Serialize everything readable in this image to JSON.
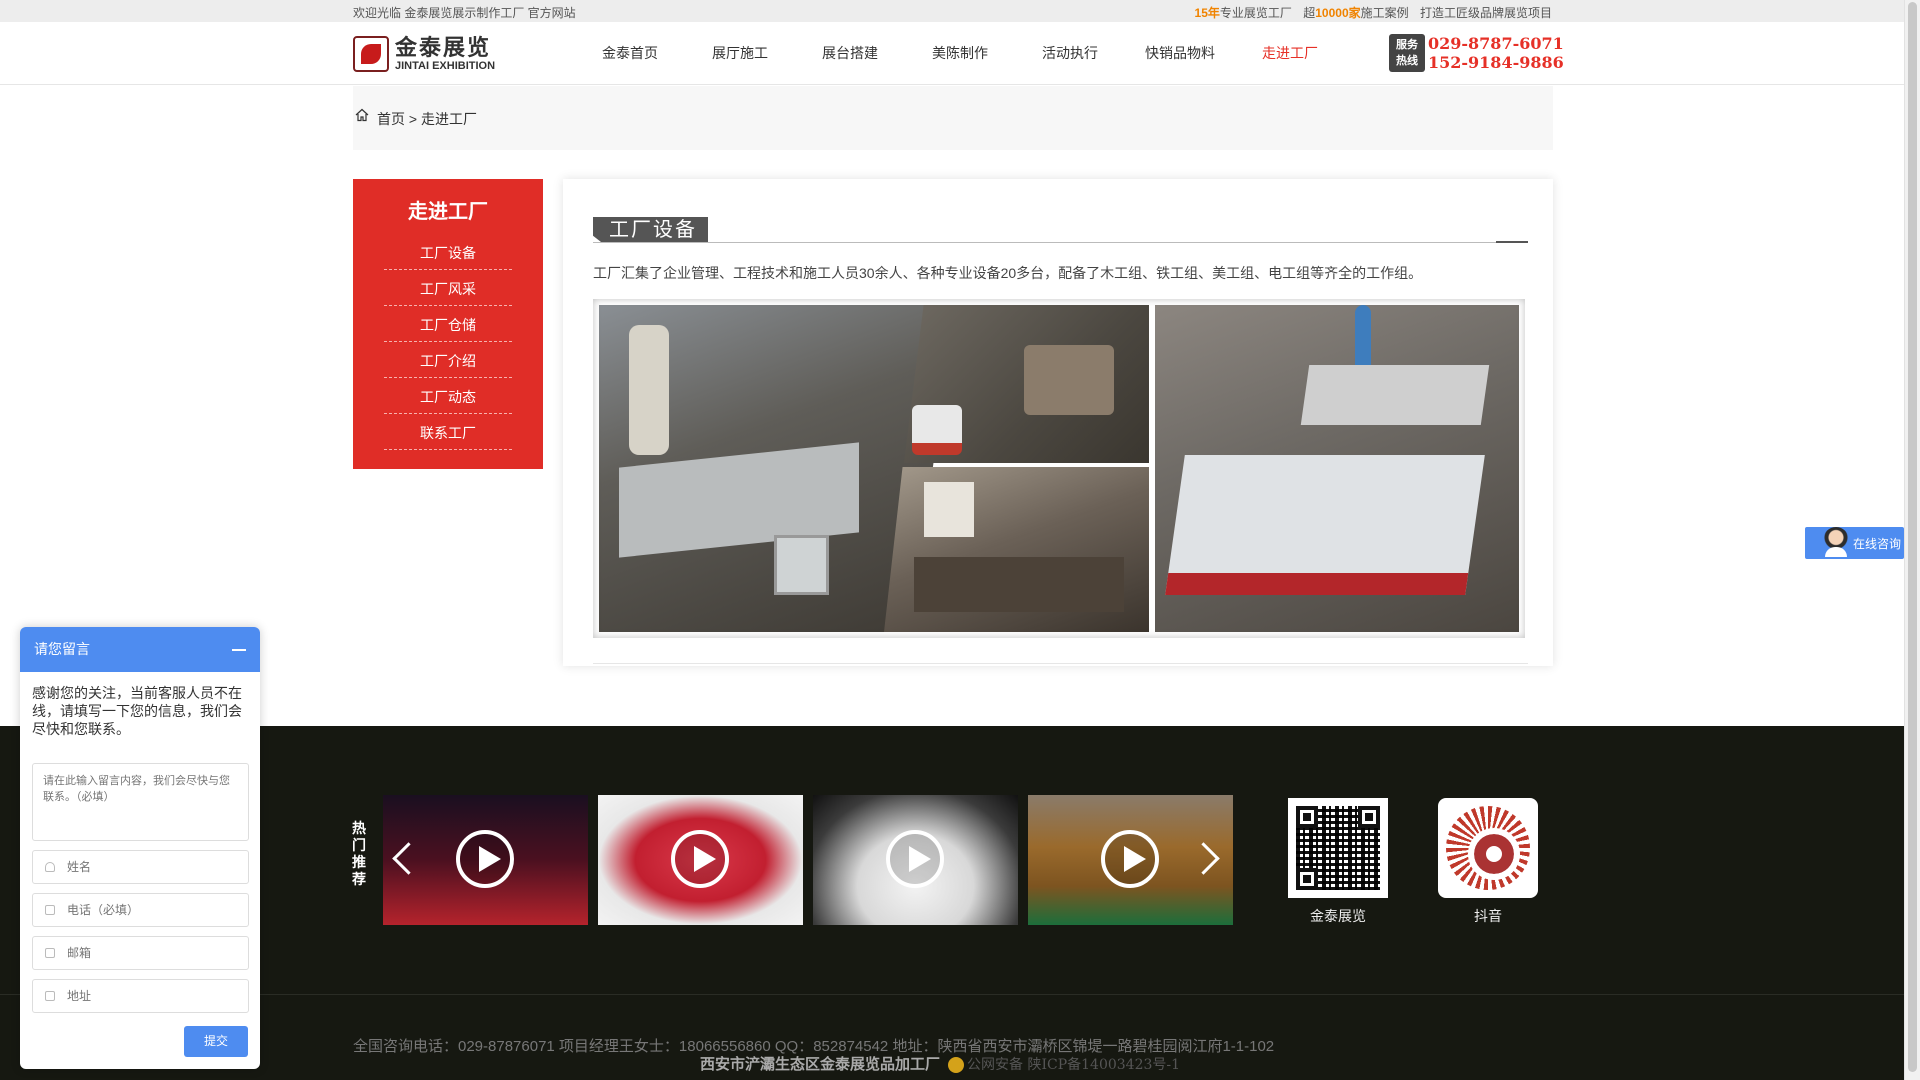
{
  "topbar": {
    "welcome": "欢迎光临 金泰展览展示制作工厂 官方网站",
    "years_num": "15年",
    "years_text": "专业展览工厂",
    "cases_prefix": "超",
    "cases_num": "10000家",
    "cases_text": "施工案例",
    "slogan": "打造工匠级品牌展览项目"
  },
  "header": {
    "logo_cn": "金泰展览",
    "logo_en": "JINTAI EXHIBITION",
    "nav": [
      {
        "label": "金泰首页"
      },
      {
        "label": "展厅施工"
      },
      {
        "label": "展台搭建"
      },
      {
        "label": "美陈制作"
      },
      {
        "label": "活动执行"
      },
      {
        "label": "快销品物料"
      },
      {
        "label": "走进工厂",
        "active": true
      }
    ],
    "hotline_badge_1": "服务",
    "hotline_badge_2": "热线",
    "phone_1": "029-8787-6071",
    "phone_2": "152-9184-9886"
  },
  "breadcrumb": {
    "home": "首页",
    "sep": ">",
    "current": "走进工厂"
  },
  "sidebar": {
    "title": "走进工厂",
    "items": [
      {
        "label": "工厂设备"
      },
      {
        "label": "工厂风采"
      },
      {
        "label": "工厂仓储"
      },
      {
        "label": "工厂介绍"
      },
      {
        "label": "工厂动态"
      },
      {
        "label": "联系工厂"
      }
    ]
  },
  "main": {
    "section_title": "工厂设备",
    "description": "工厂汇集了企业管理、工程技术和施工人员30余人、各种专业设备20多台，配备了木工组、铁工组、美工组、电工组等齐全的工作组。"
  },
  "footer": {
    "hot_label": [
      "热",
      "门",
      "推",
      "荐"
    ],
    "qr_codes": [
      {
        "label": "金泰展览"
      },
      {
        "label": "抖音"
      }
    ],
    "contact": "全国咨询电话：029-87876071 项目经理王女士：18066556860 QQ：852874542 地址：陕西省西安市灞桥区锦堤一路碧桂园阅江府1-1-102",
    "company": "西安市浐灞生态区金泰展览品加工厂",
    "icp": "公网安备 陕ICP备14003423号-1"
  },
  "consult": {
    "label": "在线咨询"
  },
  "message_widget": {
    "title": "请您留言",
    "intro": "感谢您的关注，当前客服人员不在线，请填写一下您的信息，我们会尽快和您联系。",
    "textarea_placeholder": "请在此输入留言内容，我们会尽快与您联系。（必填）",
    "name_placeholder": "姓名",
    "phone_placeholder": "电话（必填）",
    "email_placeholder": "邮箱",
    "address_placeholder": "地址",
    "submit_label": "提交"
  },
  "colors": {
    "brand_red": "#e02d27",
    "accent_orange": "#f08300",
    "widget_blue": "#4e8cf0",
    "footer_bg": "#161811"
  }
}
